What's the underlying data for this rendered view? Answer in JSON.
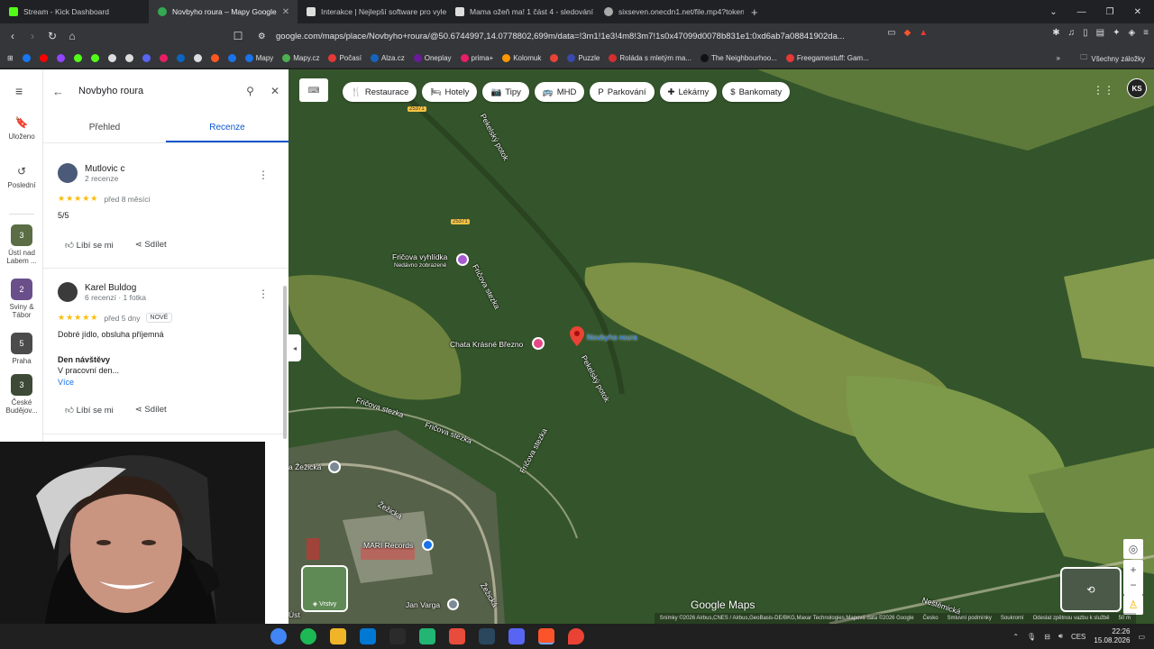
{
  "browser": {
    "tabs": [
      {
        "title": "Stream - Kick Dashboard",
        "fav_color": "#53fc18",
        "active": false
      },
      {
        "title": "Novbyho roura – Mapy Google",
        "fav_color": "#34a853",
        "active": true
      },
      {
        "title": "Interakce | Nejlepší software pro vyle",
        "fav_color": "#dddddd",
        "active": false
      },
      {
        "title": "Mama ožeň ma! 1 část 4 - sledování",
        "fav_color": "#dddddd",
        "active": false
      },
      {
        "title": "sixseven.onecdn1.net/file.mp4?token",
        "fav_color": "#aaaaaa",
        "active": false
      }
    ],
    "url": "google.com/maps/place/Novbyho+roura/@50.6744997,14.0778802,699m/data=!3m1!1e3!4m8!3m7!1s0x47099d0078b831e1:0xd6ab7a08841902da...",
    "bookmarks": [
      {
        "label": "",
        "color": "#1877f2"
      },
      {
        "label": "",
        "color": "#ff0000"
      },
      {
        "label": "",
        "color": "#9146ff"
      },
      {
        "label": "",
        "color": "#53fc18"
      },
      {
        "label": "",
        "color": "#dddddd"
      },
      {
        "label": "",
        "color": "#dddddd"
      },
      {
        "label": "",
        "color": "#5865f2"
      },
      {
        "label": "",
        "color": "#e91e63"
      },
      {
        "label": "",
        "color": "#0a66c2"
      },
      {
        "label": "",
        "color": "#dddddd"
      },
      {
        "label": "",
        "color": "#ff5722"
      },
      {
        "label": "",
        "color": "#1a73e8"
      },
      {
        "label": "",
        "color": "#0b57d0"
      },
      {
        "label": "",
        "color": "#ff6d00"
      },
      {
        "label": "Mapy",
        "color": "#1a73e8"
      },
      {
        "label": "Mapy.cz",
        "color": "#4caf50"
      },
      {
        "label": "Počasí",
        "color": "#e53935"
      },
      {
        "label": "Alza.cz",
        "color": "#1565c0"
      },
      {
        "label": "Oneplay",
        "color": "#6a1b9a"
      },
      {
        "label": "prima+",
        "color": "#e91e63"
      },
      {
        "label": "Kolomuk",
        "color": "#ff9800"
      },
      {
        "label": "",
        "color": "#ea4335"
      },
      {
        "label": "Puzzle",
        "color": "#3949ab"
      },
      {
        "label": "Roláda s mletým ma...",
        "color": "#d32f2f"
      },
      {
        "label": "The Neighbourhoo...",
        "color": "#222222"
      },
      {
        "label": "Freegamestuff: Gam...",
        "color": "#e53935"
      }
    ],
    "all_bookmarks": "Všechny záložky"
  },
  "rail": {
    "saved": "Uloženo",
    "recent": "Poslední",
    "places": [
      {
        "label": "Ústí nad Labem ...",
        "num": "3"
      },
      {
        "label": "Sviny & Tábor",
        "num": "2"
      },
      {
        "label": "Praha",
        "num": "5"
      },
      {
        "label": "České Budějov...",
        "num": "3"
      }
    ]
  },
  "panel": {
    "search_value": "Novbyho roura",
    "tab_overview": "Přehled",
    "tab_reviews": "Recenze",
    "reviews": [
      {
        "name": "Mutlovic c",
        "sub": "2 recenze",
        "when": "před 8 měsíci",
        "badge": "",
        "text": "5/5",
        "visit_title": "",
        "visit_value": "",
        "more": "",
        "like": "Líbí se mi",
        "share": "Sdílet"
      },
      {
        "name": "Karel Buldog",
        "sub": "6 recenzí · 1 fotka",
        "when": "před 5 dny",
        "badge": "NOVÉ",
        "text": "Dobré jídlo, obsluha příjemná",
        "visit_title": "Den návštěvy",
        "visit_value": "V pracovní den...",
        "more": "Více",
        "like": "Líbí se mi",
        "share": "Sdílet"
      }
    ],
    "stars": "★★★★★"
  },
  "map": {
    "chips": [
      {
        "icon": "🍴",
        "label": "Restaurace"
      },
      {
        "icon": "🛏",
        "label": "Hotely"
      },
      {
        "icon": "📷",
        "label": "Tipy"
      },
      {
        "icon": "🚌",
        "label": "MHD"
      },
      {
        "icon": "P",
        "label": "Parkování"
      },
      {
        "icon": "✚",
        "label": "Lékárny"
      },
      {
        "icon": "$",
        "label": "Bankomaty"
      }
    ],
    "road_numbers": [
      "25371",
      "25371"
    ],
    "labels": {
      "pekelsky1": "Pekelský potok",
      "pekelsky2": "Pekelský potok",
      "fricova_vyhlidka": "Fričova vyhlídka",
      "recently_viewed": "Nedávno zobrazené",
      "fricova_stezka1": "Fričova stezka",
      "fricova_stezka2": "Fričova stezka",
      "fricova_stezka3": "Fričova stezka",
      "fricova_stezka4": "Fričova stezka",
      "chata": "Chata Krásné Březno",
      "zezicka1": "a Žežická",
      "zezicka2": "Žežická",
      "zezicka3": "Žežická",
      "mari": "MARI Records",
      "jan_varga": "Jan Varga",
      "usti": "Úst",
      "nestemicka": "Neštěmická",
      "pin": "Novbyho roura",
      "layers": "Vrstvy",
      "google_maps": "Google Maps",
      "account_initials": "KS"
    },
    "attribution": [
      "Snímky ©2026 Airbus,CNES / Airbus,GeoBasis-DE/BKG,Maxar Technologies,Mapová data ©2026 Google",
      "Česko",
      "Smluvní podmínky",
      "Soukromí",
      "Odeslat zpětnou vazbu k službě",
      "50 m"
    ]
  },
  "taskbar": {
    "icons": [
      "#4285f4",
      "#1db954",
      "#f0b429",
      "#0078d4",
      "#ffffff",
      "#22b573",
      "#e74c3c",
      "#2a475e",
      "#5865f2",
      "#fb542b",
      "#ea4335"
    ],
    "lang": "CES",
    "time": "22:26",
    "date": "15.08.2026"
  }
}
